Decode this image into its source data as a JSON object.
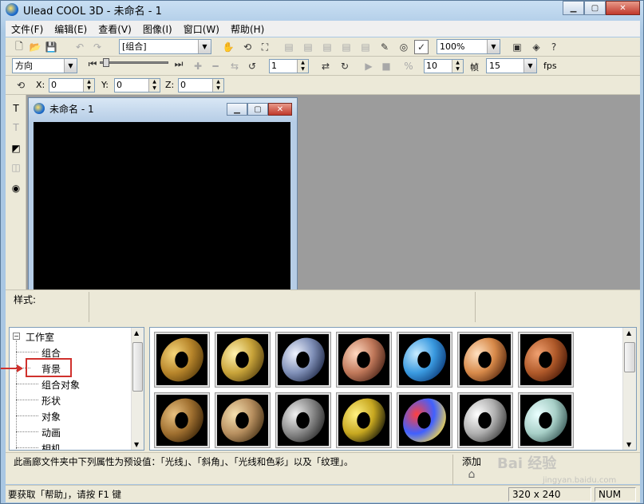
{
  "window": {
    "title": "Ulead COOL 3D - 未命名 - 1"
  },
  "menu": [
    "文件(F)",
    "编辑(E)",
    "查看(V)",
    "图像(I)",
    "窗口(W)",
    "帮助(H)"
  ],
  "toolbar1": {
    "object_select": "[组合]",
    "zoom": "100%"
  },
  "toolbar2": {
    "mode_select": "方向",
    "frame": "1",
    "frames": "10",
    "frames_label": "帧",
    "fps": "15",
    "fps_label": "fps"
  },
  "toolbar3": {
    "x_label": "X:",
    "x_value": "0",
    "y_label": "Y:",
    "y_value": "0",
    "z_label": "Z:",
    "z_value": "0"
  },
  "document": {
    "title": "未命名 - 1"
  },
  "attributes": {
    "label": "样式:"
  },
  "tree": {
    "root": "工作室",
    "items": [
      "组合",
      "背景",
      "组合对象",
      "形状",
      "对象",
      "动画",
      "相机"
    ],
    "selected": "背景"
  },
  "thumbnails": [
    {
      "name": "gold-matte",
      "colors": [
        "#f5d57a",
        "#b8862b",
        "#5a3d0c"
      ]
    },
    {
      "name": "gold-shiny",
      "colors": [
        "#fff2b0",
        "#c9a43a",
        "#5c4510"
      ]
    },
    {
      "name": "chrome-blue",
      "colors": [
        "#f0f4ff",
        "#8090b8",
        "#202a48"
      ]
    },
    {
      "name": "copper",
      "colors": [
        "#ffd8c0",
        "#c0785a",
        "#4a2418"
      ]
    },
    {
      "name": "blue-water",
      "colors": [
        "#c8ecff",
        "#3a9ae0",
        "#0c3a78"
      ]
    },
    {
      "name": "peach-ring",
      "colors": [
        "#ffe0c0",
        "#d88a4a",
        "#5a2a10"
      ]
    },
    {
      "name": "wood",
      "colors": [
        "#f0a070",
        "#b05a2a",
        "#4a1a08"
      ]
    },
    {
      "name": "bronze-rough",
      "colors": [
        "#e8c080",
        "#a07030",
        "#3a2408"
      ]
    },
    {
      "name": "spotted-gold",
      "colors": [
        "#f5e0b0",
        "#b89060",
        "#4a3418"
      ]
    },
    {
      "name": "checker-gray",
      "colors": [
        "#f0f0f0",
        "#8a8a8a",
        "#2a2a2a"
      ]
    },
    {
      "name": "leopard",
      "colors": [
        "#fff080",
        "#c8a820",
        "#1a1a0a"
      ]
    },
    {
      "name": "multicolor",
      "colors": [
        "#ff4040",
        "#4060ff",
        "#ffe040"
      ]
    },
    {
      "name": "silver",
      "colors": [
        "#ffffff",
        "#b0b0b0",
        "#404040"
      ]
    },
    {
      "name": "jade-glass",
      "colors": [
        "#eaffff",
        "#a8d0c8",
        "#3a5a58"
      ]
    }
  ],
  "description": "此画廊文件夹中下列属性为预设值：「光线」、「斜角」、「光线和色彩」以及「纹理」。",
  "add_button": "添加",
  "status": {
    "help_text": "要获取「帮助」，请按 F1 键",
    "size": "320 x 240",
    "num": "NUM"
  },
  "watermark": {
    "logo": "Bai 经验",
    "url": "jingyan.baidu.com"
  }
}
